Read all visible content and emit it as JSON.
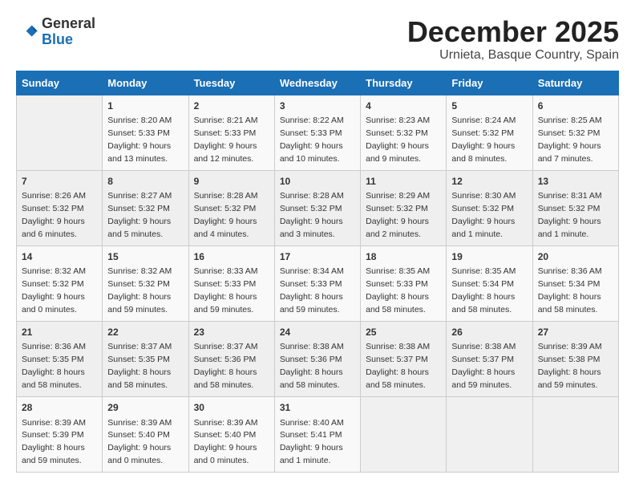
{
  "logo": {
    "general": "General",
    "blue": "Blue"
  },
  "title": "December 2025",
  "subtitle": "Urnieta, Basque Country, Spain",
  "days_of_week": [
    "Sunday",
    "Monday",
    "Tuesday",
    "Wednesday",
    "Thursday",
    "Friday",
    "Saturday"
  ],
  "weeks": [
    [
      {
        "day": "",
        "info": ""
      },
      {
        "day": "1",
        "info": "Sunrise: 8:20 AM\nSunset: 5:33 PM\nDaylight: 9 hours\nand 13 minutes."
      },
      {
        "day": "2",
        "info": "Sunrise: 8:21 AM\nSunset: 5:33 PM\nDaylight: 9 hours\nand 12 minutes."
      },
      {
        "day": "3",
        "info": "Sunrise: 8:22 AM\nSunset: 5:33 PM\nDaylight: 9 hours\nand 10 minutes."
      },
      {
        "day": "4",
        "info": "Sunrise: 8:23 AM\nSunset: 5:32 PM\nDaylight: 9 hours\nand 9 minutes."
      },
      {
        "day": "5",
        "info": "Sunrise: 8:24 AM\nSunset: 5:32 PM\nDaylight: 9 hours\nand 8 minutes."
      },
      {
        "day": "6",
        "info": "Sunrise: 8:25 AM\nSunset: 5:32 PM\nDaylight: 9 hours\nand 7 minutes."
      }
    ],
    [
      {
        "day": "7",
        "info": "Sunrise: 8:26 AM\nSunset: 5:32 PM\nDaylight: 9 hours\nand 6 minutes."
      },
      {
        "day": "8",
        "info": "Sunrise: 8:27 AM\nSunset: 5:32 PM\nDaylight: 9 hours\nand 5 minutes."
      },
      {
        "day": "9",
        "info": "Sunrise: 8:28 AM\nSunset: 5:32 PM\nDaylight: 9 hours\nand 4 minutes."
      },
      {
        "day": "10",
        "info": "Sunrise: 8:28 AM\nSunset: 5:32 PM\nDaylight: 9 hours\nand 3 minutes."
      },
      {
        "day": "11",
        "info": "Sunrise: 8:29 AM\nSunset: 5:32 PM\nDaylight: 9 hours\nand 2 minutes."
      },
      {
        "day": "12",
        "info": "Sunrise: 8:30 AM\nSunset: 5:32 PM\nDaylight: 9 hours\nand 1 minute."
      },
      {
        "day": "13",
        "info": "Sunrise: 8:31 AM\nSunset: 5:32 PM\nDaylight: 9 hours\nand 1 minute."
      }
    ],
    [
      {
        "day": "14",
        "info": "Sunrise: 8:32 AM\nSunset: 5:32 PM\nDaylight: 9 hours\nand 0 minutes."
      },
      {
        "day": "15",
        "info": "Sunrise: 8:32 AM\nSunset: 5:32 PM\nDaylight: 8 hours\nand 59 minutes."
      },
      {
        "day": "16",
        "info": "Sunrise: 8:33 AM\nSunset: 5:33 PM\nDaylight: 8 hours\nand 59 minutes."
      },
      {
        "day": "17",
        "info": "Sunrise: 8:34 AM\nSunset: 5:33 PM\nDaylight: 8 hours\nand 59 minutes."
      },
      {
        "day": "18",
        "info": "Sunrise: 8:35 AM\nSunset: 5:33 PM\nDaylight: 8 hours\nand 58 minutes."
      },
      {
        "day": "19",
        "info": "Sunrise: 8:35 AM\nSunset: 5:34 PM\nDaylight: 8 hours\nand 58 minutes."
      },
      {
        "day": "20",
        "info": "Sunrise: 8:36 AM\nSunset: 5:34 PM\nDaylight: 8 hours\nand 58 minutes."
      }
    ],
    [
      {
        "day": "21",
        "info": "Sunrise: 8:36 AM\nSunset: 5:35 PM\nDaylight: 8 hours\nand 58 minutes."
      },
      {
        "day": "22",
        "info": "Sunrise: 8:37 AM\nSunset: 5:35 PM\nDaylight: 8 hours\nand 58 minutes."
      },
      {
        "day": "23",
        "info": "Sunrise: 8:37 AM\nSunset: 5:36 PM\nDaylight: 8 hours\nand 58 minutes."
      },
      {
        "day": "24",
        "info": "Sunrise: 8:38 AM\nSunset: 5:36 PM\nDaylight: 8 hours\nand 58 minutes."
      },
      {
        "day": "25",
        "info": "Sunrise: 8:38 AM\nSunset: 5:37 PM\nDaylight: 8 hours\nand 58 minutes."
      },
      {
        "day": "26",
        "info": "Sunrise: 8:38 AM\nSunset: 5:37 PM\nDaylight: 8 hours\nand 59 minutes."
      },
      {
        "day": "27",
        "info": "Sunrise: 8:39 AM\nSunset: 5:38 PM\nDaylight: 8 hours\nand 59 minutes."
      }
    ],
    [
      {
        "day": "28",
        "info": "Sunrise: 8:39 AM\nSunset: 5:39 PM\nDaylight: 8 hours\nand 59 minutes."
      },
      {
        "day": "29",
        "info": "Sunrise: 8:39 AM\nSunset: 5:40 PM\nDaylight: 9 hours\nand 0 minutes."
      },
      {
        "day": "30",
        "info": "Sunrise: 8:39 AM\nSunset: 5:40 PM\nDaylight: 9 hours\nand 0 minutes."
      },
      {
        "day": "31",
        "info": "Sunrise: 8:40 AM\nSunset: 5:41 PM\nDaylight: 9 hours\nand 1 minute."
      },
      {
        "day": "",
        "info": ""
      },
      {
        "day": "",
        "info": ""
      },
      {
        "day": "",
        "info": ""
      }
    ]
  ]
}
